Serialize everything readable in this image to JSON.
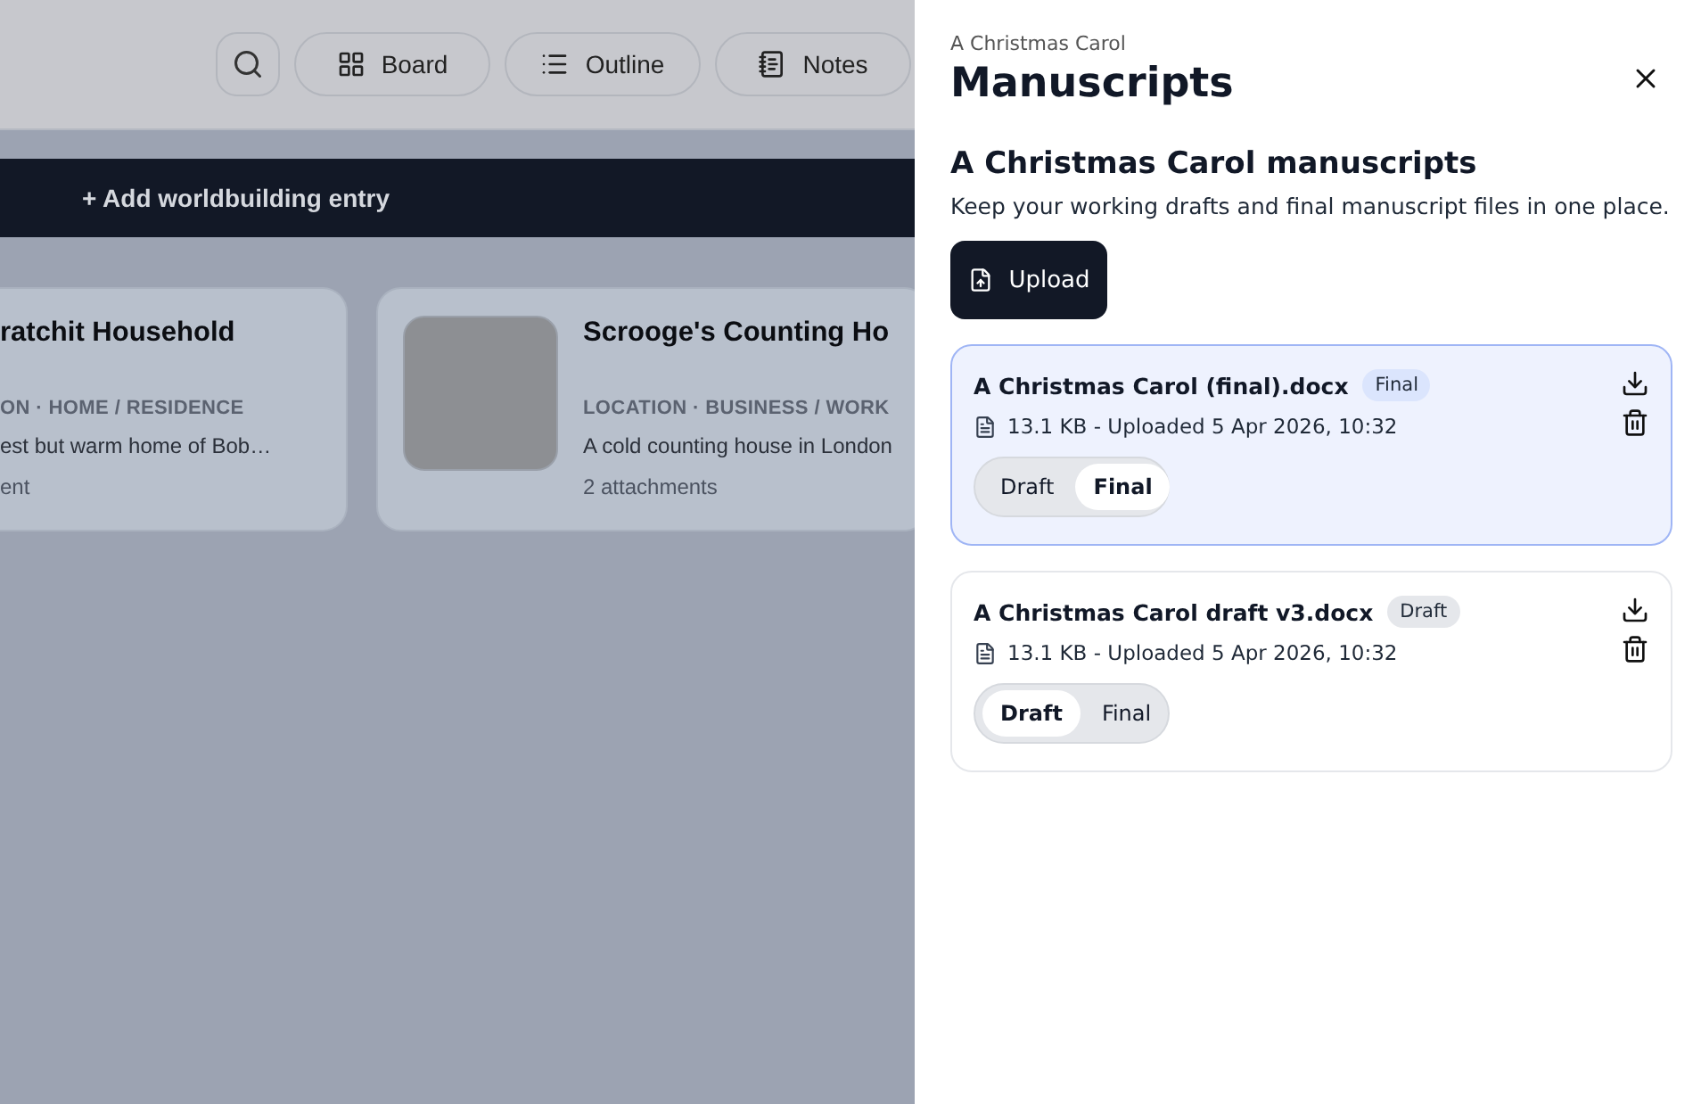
{
  "toolbar": {
    "buttons": [
      {
        "kind": "search"
      },
      {
        "kind": "board",
        "label": "Board"
      },
      {
        "kind": "outline",
        "label": "Outline"
      },
      {
        "kind": "notes",
        "label": "Notes"
      }
    ]
  },
  "add_button": {
    "label": "+ Add worldbuilding entry"
  },
  "cards": [
    {
      "title": "ratchit Household",
      "tags": "ON · HOME / RESIDENCE",
      "description": "est but warm home of Bob…",
      "attachments": "ent",
      "has_image": false
    },
    {
      "title": "Scrooge's Counting Ho",
      "tags": "LOCATION · BUSINESS / WORK",
      "description": "A cold counting house in London",
      "attachments": "2 attachments",
      "has_image": true
    }
  ],
  "panel": {
    "eyebrow": "A Christmas Carol",
    "title": "Manuscripts",
    "section_title": "A Christmas Carol manuscripts",
    "description": "Keep your working drafts and final manuscript files in one place.",
    "upload_label": "Upload",
    "files": [
      {
        "name": "A Christmas Carol (final).docx",
        "badge": {
          "label": "Final",
          "color": "#dbe5fd"
        },
        "meta": "13.1 KB - Uploaded 5 Apr 2026, 10:32",
        "selected": true,
        "options": [
          {
            "label": "Draft",
            "selected": false
          },
          {
            "label": "Final",
            "selected": true
          }
        ]
      },
      {
        "name": "A Christmas Carol draft v3.docx",
        "badge": {
          "label": "Draft",
          "color": "#e5e7eb"
        },
        "meta": "13.1 KB - Uploaded 5 Apr 2026, 10:32",
        "selected": false,
        "options": [
          {
            "label": "Draft",
            "selected": true
          },
          {
            "label": "Final",
            "selected": false
          }
        ]
      }
    ]
  }
}
